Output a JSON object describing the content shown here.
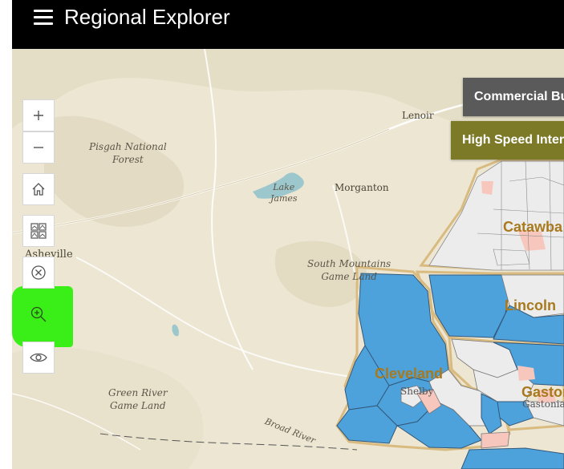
{
  "header": {
    "title": "Regional Explorer",
    "menu_icon": "hamburger-menu-icon"
  },
  "map": {
    "place_labels": {
      "lenoir": "Lenoir",
      "morganton": "Morganton",
      "asheville": "Asheville",
      "shelby": "Shelby",
      "gastonia": "Gastonia"
    },
    "area_labels": {
      "pisgah": "Pisgah National\nForest",
      "lake_james": "Lake\nJames",
      "south_mountains": "South Mountains\nGame Land",
      "green_river": "Green River\nGame Land",
      "broad_river": "Broad River"
    },
    "county_labels": {
      "catawba": "Catawba",
      "lincoln": "Lincoln",
      "cleveland": "Cleveland",
      "gaston": "Gaston"
    },
    "colors": {
      "tract_fill": "#4da2dc",
      "tract_gray": "#ececec",
      "tract_pink": "#f7c7be",
      "county_border": "#d9bb80",
      "county_label": "#a8791d",
      "terrain": "#ece6d3",
      "highlight": "#33ee11"
    }
  },
  "toolbar": {
    "zoom_in_icon": "plus-icon",
    "zoom_out_icon": "minus-icon",
    "home_icon": "home-icon",
    "basemap_icon": "basemap-gallery-icon",
    "clear_icon": "close-circle-icon",
    "zoom_to_icon": "zoom-in-icon",
    "view_icon": "eye-icon"
  },
  "layer_buttons": {
    "commercial": {
      "label": "Commercial Bu",
      "color": "#5a5a5a"
    },
    "high_speed": {
      "label": "High Speed Inter",
      "color": "#7c7a27"
    }
  }
}
